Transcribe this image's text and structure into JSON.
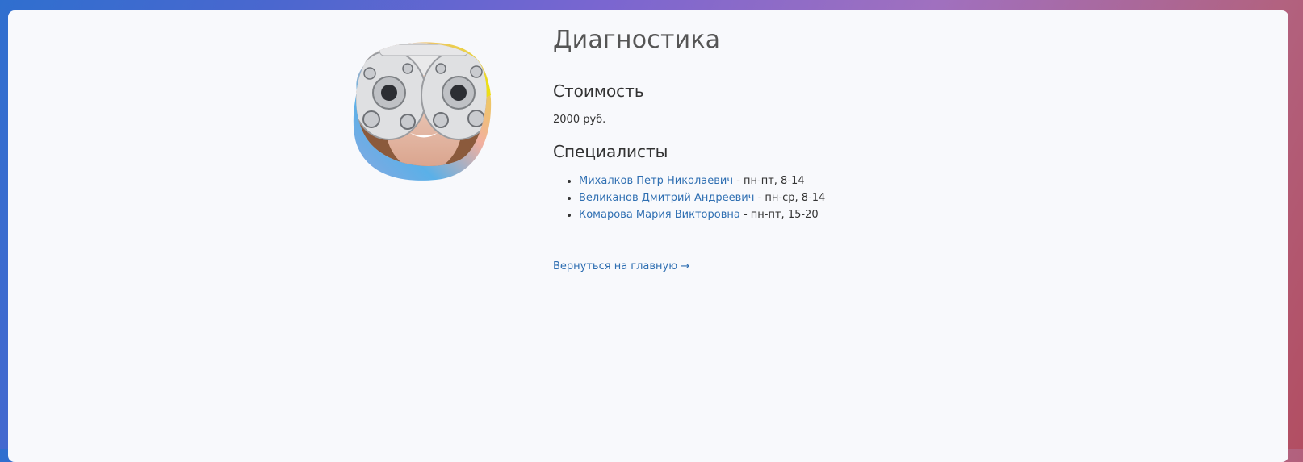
{
  "page": {
    "title": "Диагностика",
    "price_heading": "Стоимость",
    "price_value": "2000 руб.",
    "specialists_heading": "Специалисты",
    "specialists": [
      {
        "name": "Михалков Петр Николаевич",
        "schedule": " - пн-пт, 8-14"
      },
      {
        "name": "Великанов Дмитрий Андреевич",
        "schedule": " - пн-ср, 8-14"
      },
      {
        "name": "Комарова Мария Викторовна",
        "schedule": " - пн-пт, 15-20"
      }
    ],
    "back_link": "Вернуться на главную →"
  },
  "colors": {
    "link": "#2f6fb2",
    "heading": "#555555",
    "blob_yellow": "#f0e01a",
    "blob_blue": "#3f9fe0",
    "blob_pink": "#f0a0c0"
  }
}
